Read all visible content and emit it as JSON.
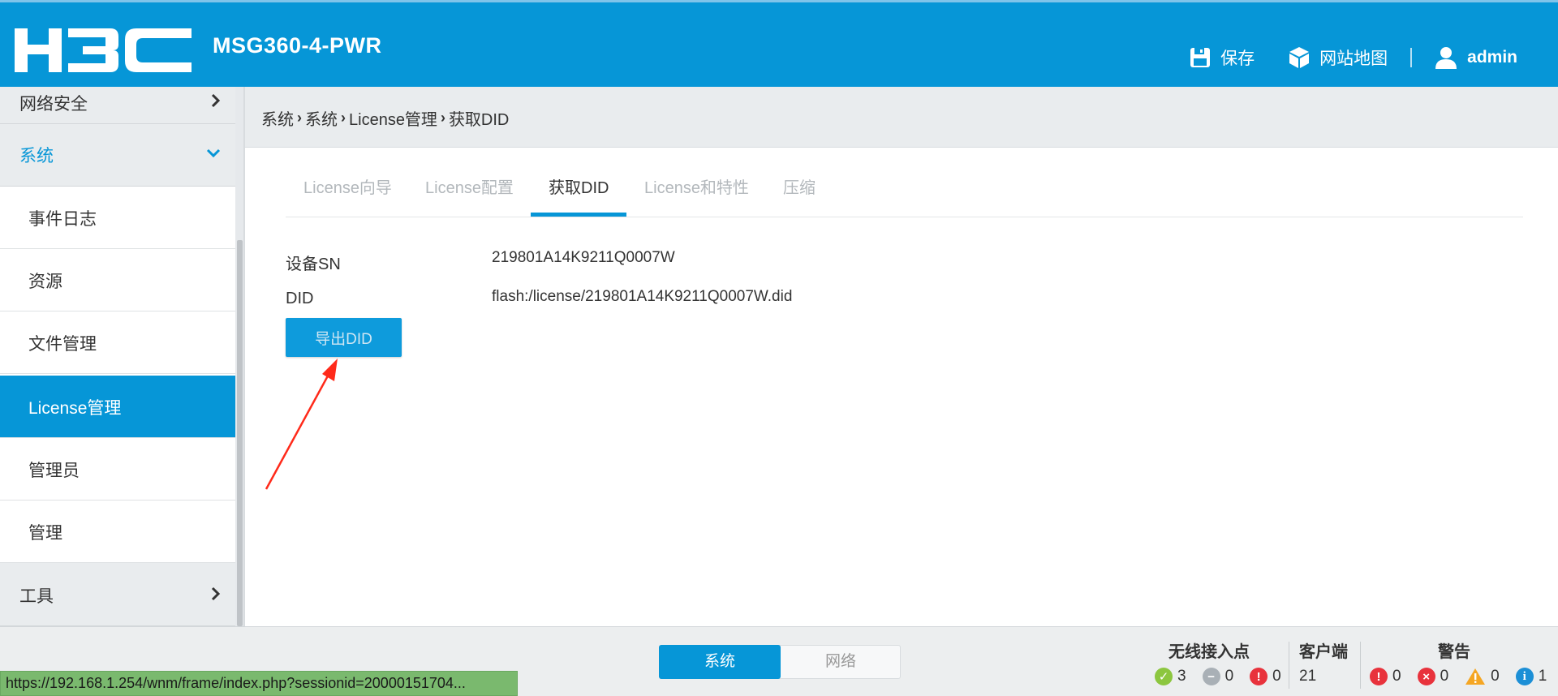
{
  "header": {
    "brand": "H3C",
    "device_name": "MSG360-4-PWR",
    "save_label": "保存",
    "sitemap_label": "网站地图",
    "user_label": "admin"
  },
  "sidebar": {
    "groups": [
      {
        "label": "网络安全"
      },
      {
        "label": "系统"
      },
      {
        "label": "工具"
      }
    ],
    "items": [
      {
        "label": "事件日志"
      },
      {
        "label": "资源"
      },
      {
        "label": "文件管理"
      },
      {
        "label": "License管理"
      },
      {
        "label": "管理员"
      },
      {
        "label": "管理"
      }
    ]
  },
  "breadcrumb": [
    "系统",
    "系统",
    "License管理",
    "获取DID"
  ],
  "tabs": [
    {
      "label": "License向导"
    },
    {
      "label": "License配置"
    },
    {
      "label": "获取DID"
    },
    {
      "label": "License和特性"
    },
    {
      "label": "压缩"
    }
  ],
  "content": {
    "sn_label": "设备SN",
    "sn_value": "219801A14K9211Q0007W",
    "did_label": "DID",
    "did_value": "flash:/license/219801A14K9211Q0007W.did",
    "export_button": "导出DID"
  },
  "footer": {
    "seg_system": "系统",
    "seg_network": "网络",
    "ap_title": "无线接入点",
    "ap_online": "3",
    "ap_offline": "0",
    "ap_fault": "0",
    "client_title": "客户端",
    "client_count": "21",
    "alarm_title": "警告",
    "alarm_critical": "0",
    "alarm_major": "0",
    "alarm_minor": "0",
    "alarm_info": "1"
  },
  "statusbar": {
    "url": "https://192.168.1.254/wnm/frame/index.php?sessionid=20000151704..."
  },
  "colors": {
    "accent": "#0696d7",
    "status_bar": "#7ab96e",
    "annotation_arrow": "#ff2a1a"
  }
}
